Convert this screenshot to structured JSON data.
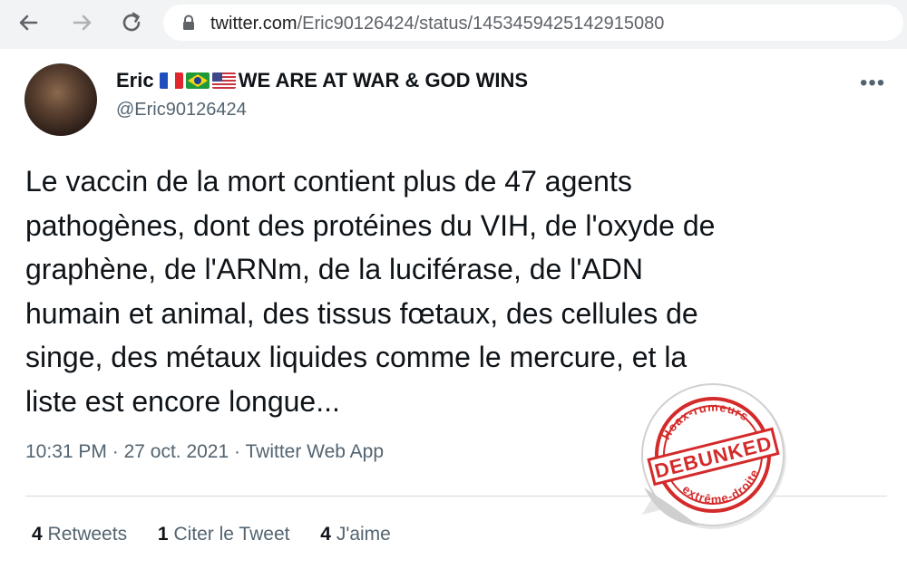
{
  "browser": {
    "url_host": "twitter.com",
    "url_path": "/Eric90126424/status/1453459425142915080"
  },
  "tweet": {
    "author_name": "Eric",
    "author_name_suffix": "WE ARE AT WAR & GOD WINS",
    "flags": [
      "flag-france-icon",
      "flag-brazil-icon",
      "flag-usa-icon"
    ],
    "handle": "@Eric90126424",
    "text_lines": [
      "Le vaccin de la mort contient plus de 47 agents",
      "pathogènes, dont des protéines du VIH, de l'oxyde de",
      "graphène, de l'ARNm, de la luciférase, de l'ADN",
      "humain et animal, des tissus fœtaux, des cellules de",
      "singe, des métaux liquides comme le mercure, et la",
      "liste est encore longue..."
    ],
    "time": "10:31 PM",
    "date": "27 oct. 2021",
    "source": "Twitter Web App",
    "separator": "·",
    "stats": [
      {
        "count": "4",
        "label": "Retweets"
      },
      {
        "count": "1",
        "label": "Citer le Tweet"
      },
      {
        "count": "4",
        "label": "J'aime"
      }
    ]
  },
  "stamp": {
    "top_text": "Hoax-rumeurs",
    "main_text": "DEBUNKED",
    "bottom_text": "extrême-droite",
    "color": "#d42a2a"
  }
}
